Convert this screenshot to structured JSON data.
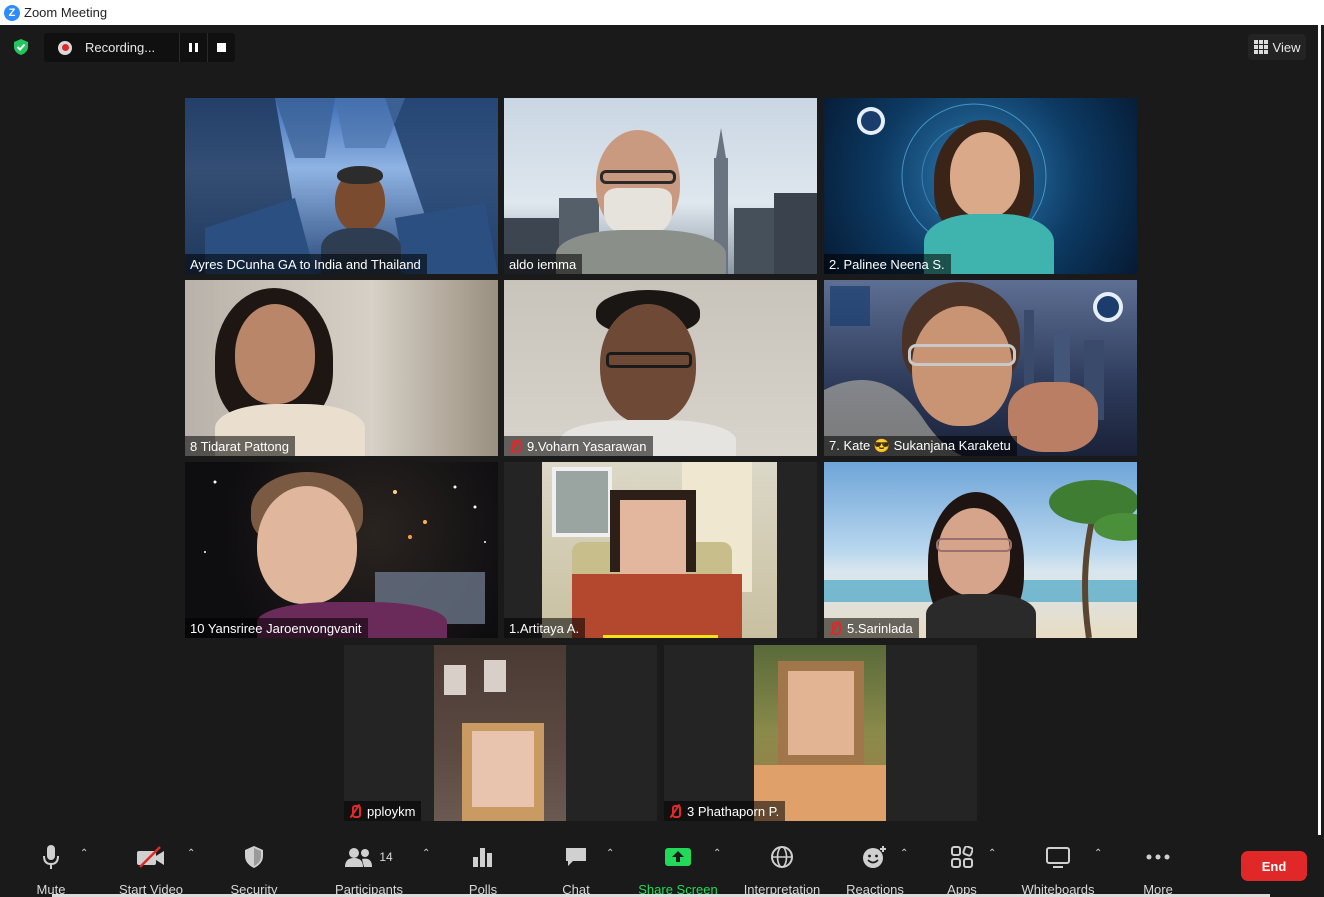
{
  "window": {
    "title": "Zoom Meeting",
    "logo_letter": "Z"
  },
  "recording": {
    "label": "Recording..."
  },
  "view_button": {
    "label": "View"
  },
  "participants": [
    {
      "name": "Ayres DCunha GA to India and Thailand",
      "muted": false
    },
    {
      "name": "aldo iemma",
      "muted": false
    },
    {
      "name": "2. Palinee Neena S.",
      "muted": false
    },
    {
      "name": "8 Tidarat Pattong",
      "muted": false
    },
    {
      "name": "9.Voharn Yasarawan",
      "muted": true
    },
    {
      "name": "7. Kate 😎 Sukanjana Karaketu",
      "muted": false
    },
    {
      "name": "10 Yansriree Jaroenvongvanit",
      "muted": false
    },
    {
      "name": "1.Artitaya A.",
      "muted": false
    },
    {
      "name": "5.Sarinlada",
      "muted": true
    },
    {
      "name": "pploykm",
      "muted": true
    },
    {
      "name": "3 Phathaporn P.",
      "muted": true
    }
  ],
  "toolbar": {
    "mute": "Mute",
    "start_video": "Start Video",
    "security": "Security",
    "participants": "Participants",
    "participants_count": "14",
    "polls": "Polls",
    "chat": "Chat",
    "share_screen": "Share Screen",
    "interpretation": "Interpretation",
    "reactions": "Reactions",
    "apps": "Apps",
    "whiteboards": "Whiteboards",
    "more": "More",
    "end": "End"
  },
  "colors": {
    "share_green": "#23d959",
    "end_red": "#e02828",
    "speaker_highlight": "#f5e11a"
  }
}
